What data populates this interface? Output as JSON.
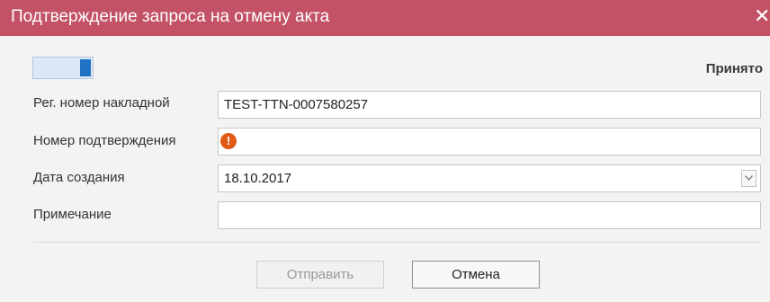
{
  "dialog": {
    "title": "Подтверждение запроса на отмену акта",
    "close_glyph": "✕",
    "accent_color": "#c35266"
  },
  "toggle": {
    "state": "on",
    "status_label": "Принято"
  },
  "form": {
    "waybill_number": {
      "label": "Рег. номер накладной",
      "value": "TEST-TTN-0007580257"
    },
    "confirmation_number": {
      "label": "Номер подтверждения",
      "value": "",
      "error_icon": "error-exclamation-icon",
      "error_glyph": "!"
    },
    "creation_date": {
      "label": "Дата создания",
      "value": "18.10.2017",
      "dropdown_icon": "chevron-down-icon"
    },
    "note": {
      "label": "Примечание",
      "value": ""
    }
  },
  "buttons": {
    "send_label": "Отправить",
    "cancel_label": "Отмена"
  }
}
